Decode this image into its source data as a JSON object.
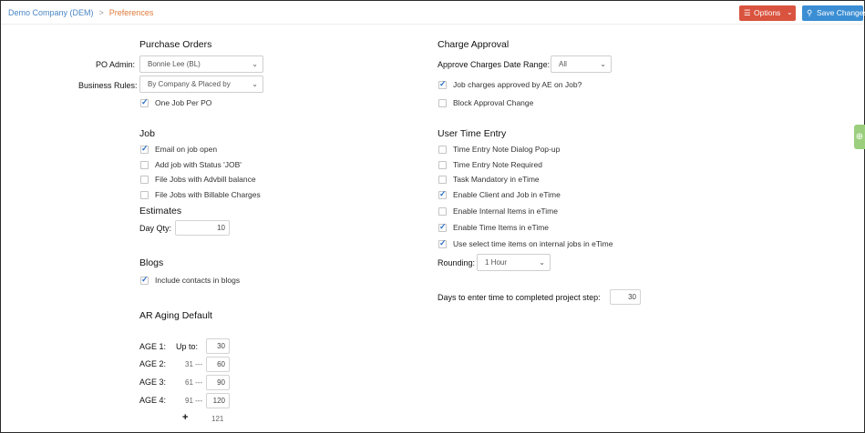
{
  "breadcrumb": {
    "company": "Demo Company (DEM)",
    "separator": ">",
    "current": "Preferences"
  },
  "toolbar": {
    "options_label": "Options",
    "save_label": "Save Changes"
  },
  "colors": {
    "options_button": "#d9533f",
    "save_button": "#3b8ed3",
    "breadcrumb_link": "#4a86c5",
    "breadcrumb_current": "#e07a3a",
    "checkbox_check": "#2a6fc4",
    "side_tab": "#9bcf7e"
  },
  "purchase_orders": {
    "title": "Purchase Orders",
    "po_admin_label": "PO Admin:",
    "po_admin_value": "Bonnie Lee (BL)",
    "business_rules_label": "Business Rules:",
    "business_rules_value": "By Company & Placed by",
    "one_job_label": "One Job Per PO",
    "one_job_checked": true
  },
  "job": {
    "title": "Job",
    "options": [
      {
        "label": "Email on job open",
        "checked": true
      },
      {
        "label": "Add job with Status 'JOB'",
        "checked": false
      },
      {
        "label": "File Jobs with Advbill balance",
        "checked": false
      },
      {
        "label": "File Jobs with Billable Charges",
        "checked": false
      }
    ]
  },
  "estimates": {
    "title": "Estimates",
    "day_qty_label": "Day Qty:",
    "day_qty_value": "10"
  },
  "blogs": {
    "title": "Blogs",
    "include_contacts_label": "Include contacts in blogs",
    "include_contacts_checked": true
  },
  "ar_aging": {
    "title": "AR Aging Default",
    "up_to_label": "Up to:",
    "rows": [
      {
        "label": "AGE 1:",
        "from": "",
        "to": "30"
      },
      {
        "label": "AGE 2:",
        "from": "31 ---",
        "to": "60"
      },
      {
        "label": "AGE 3:",
        "from": "61 ---",
        "to": "90"
      },
      {
        "label": "AGE 4:",
        "from": "91 ---",
        "to": "120"
      }
    ],
    "plus_label": "+",
    "plus_value": "121"
  },
  "charge_approval": {
    "title": "Charge Approval",
    "date_range_label": "Approve Charges Date Range:",
    "date_range_value": "All",
    "options": [
      {
        "label": "Job charges approved by AE on Job?",
        "checked": true
      },
      {
        "label": "Block Approval Change",
        "checked": false
      }
    ]
  },
  "user_time_entry": {
    "title": "User Time Entry",
    "options": [
      {
        "label": "Time Entry Note Dialog Pop-up",
        "checked": false
      },
      {
        "label": "Time Entry Note Required",
        "checked": false
      },
      {
        "label": "Task Mandatory in eTime",
        "checked": false
      },
      {
        "label": "Enable Client and Job in eTime",
        "checked": true
      },
      {
        "label": "Enable Internal Items in eTime",
        "checked": false
      },
      {
        "label": "Enable Time Items in eTime",
        "checked": true
      },
      {
        "label": "Use select time items on internal jobs in eTime",
        "checked": true
      }
    ],
    "rounding_label": "Rounding:",
    "rounding_value": "1 Hour",
    "days_label": "Days to enter time to completed project step:",
    "days_value": "30"
  }
}
